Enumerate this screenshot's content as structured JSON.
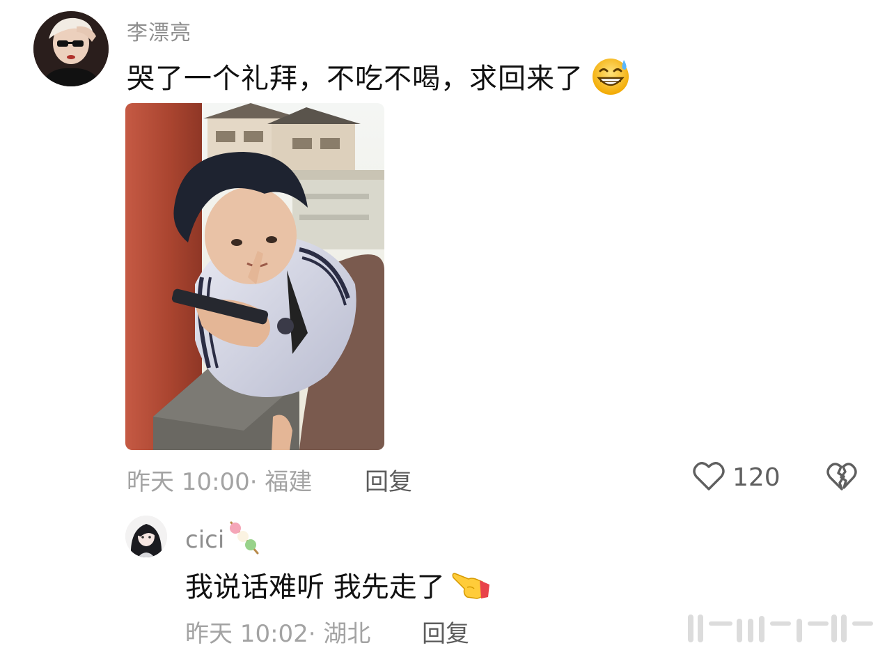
{
  "main_comment": {
    "author": "李漂亮",
    "text": "哭了一个礼拜，不吃不喝，求回来了",
    "emoji": "grinning-sweat-emoji",
    "time_location": "昨天 10:00· 福建",
    "reply_label": "回复",
    "like_count": "120"
  },
  "reply_comment": {
    "author": "cici",
    "author_emoji": "dango-emoji",
    "text": "我说话难听 我先走了",
    "text_emoji": "pointing-hand-emoji",
    "time_location": "昨天 10:02· 湖北",
    "reply_label": "回复"
  },
  "colors": {
    "meta": "#a3a3a3",
    "author": "#8e8e8e",
    "action": "#5c5c5c",
    "text": "#111111"
  }
}
